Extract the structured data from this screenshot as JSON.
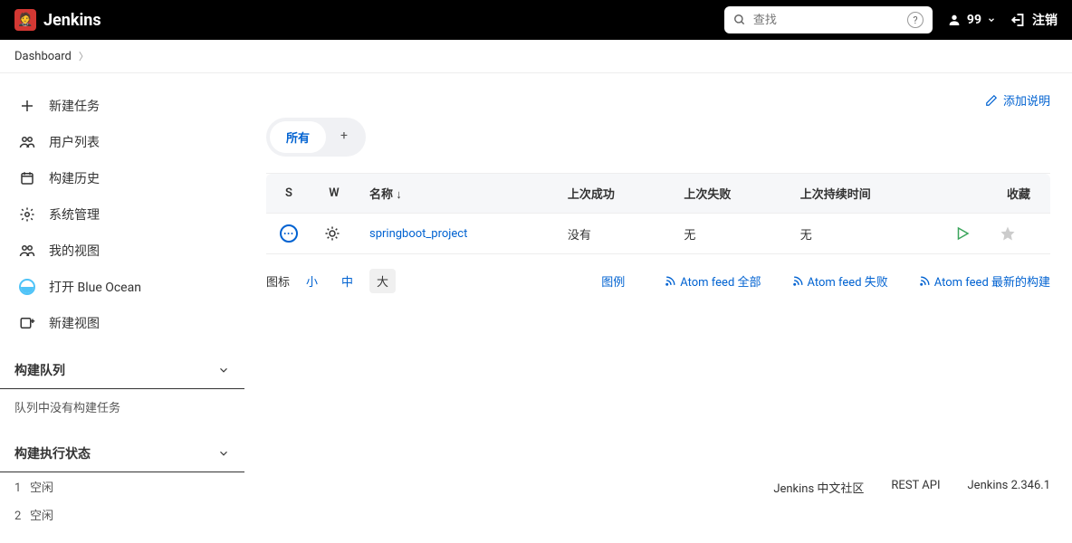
{
  "header": {
    "brand": "Jenkins",
    "search_placeholder": "查找",
    "user_label": "99",
    "logout_label": "注销"
  },
  "breadcrumb": {
    "items": [
      "Dashboard"
    ]
  },
  "sidebar": {
    "links": [
      {
        "label": "新建任务"
      },
      {
        "label": "用户列表"
      },
      {
        "label": "构建历史"
      },
      {
        "label": "系统管理"
      },
      {
        "label": "我的视图"
      },
      {
        "label": "打开 Blue Ocean"
      },
      {
        "label": "新建视图"
      }
    ],
    "queue": {
      "title": "构建队列",
      "empty": "队列中没有构建任务"
    },
    "executors": {
      "title": "构建执行状态",
      "items": [
        {
          "id": "1",
          "state": "空闲"
        },
        {
          "id": "2",
          "state": "空闲"
        }
      ]
    }
  },
  "main": {
    "add_description": "添加说明",
    "tabs": {
      "active": "所有"
    },
    "columns": {
      "status": "S",
      "weather": "W",
      "name": "名称",
      "sort": "↓",
      "last_success": "上次成功",
      "last_failure": "上次失败",
      "last_duration": "上次持续时间",
      "favorite": "收藏"
    },
    "rows": [
      {
        "name": "springboot_project",
        "last_success": "没有",
        "last_failure": "无",
        "last_duration": "无"
      }
    ],
    "icon_sizes": {
      "label": "图标",
      "small": "小",
      "medium": "中",
      "large": "大"
    },
    "legend": "图例",
    "feeds": {
      "all": "Atom feed 全部",
      "fail": "Atom feed 失败",
      "latest": "Atom feed 最新的构建"
    }
  },
  "footer": {
    "community": "Jenkins 中文社区",
    "rest": "REST API",
    "version": "Jenkins 2.346.1"
  }
}
